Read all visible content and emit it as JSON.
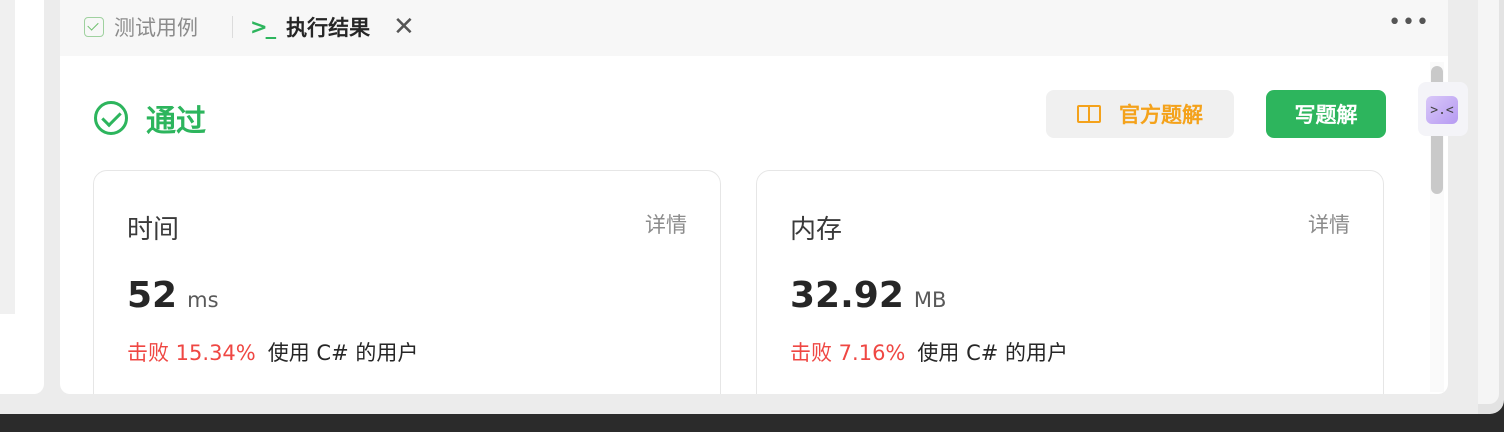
{
  "tabs": [
    {
      "label": "测试用例"
    },
    {
      "label": "执行结果"
    }
  ],
  "status": {
    "label": "通过"
  },
  "buttons": {
    "official_solution": "官方题解",
    "write_solution": "写题解"
  },
  "metrics": [
    {
      "title": "时间",
      "detail": "详情",
      "value": "52",
      "unit": "ms",
      "beats": "击败 15.34%",
      "suffix": "使用 C# 的用户"
    },
    {
      "title": "内存",
      "detail": "详情",
      "value": "32.92",
      "unit": "MB",
      "beats": "击败 7.16%",
      "suffix": "使用 C# 的用户"
    }
  ],
  "icons": {
    "tab_cases": "checkbox-icon",
    "tab_result": "terminal-icon",
    "close": "close-icon",
    "more": "more-icon",
    "status": "check-circle-icon",
    "solution": "book-icon",
    "float": "code-collapse-icon"
  },
  "colors": {
    "accent_green": "#2db55d",
    "accent_orange": "#f4a21b",
    "beat_red": "#ef4743"
  }
}
